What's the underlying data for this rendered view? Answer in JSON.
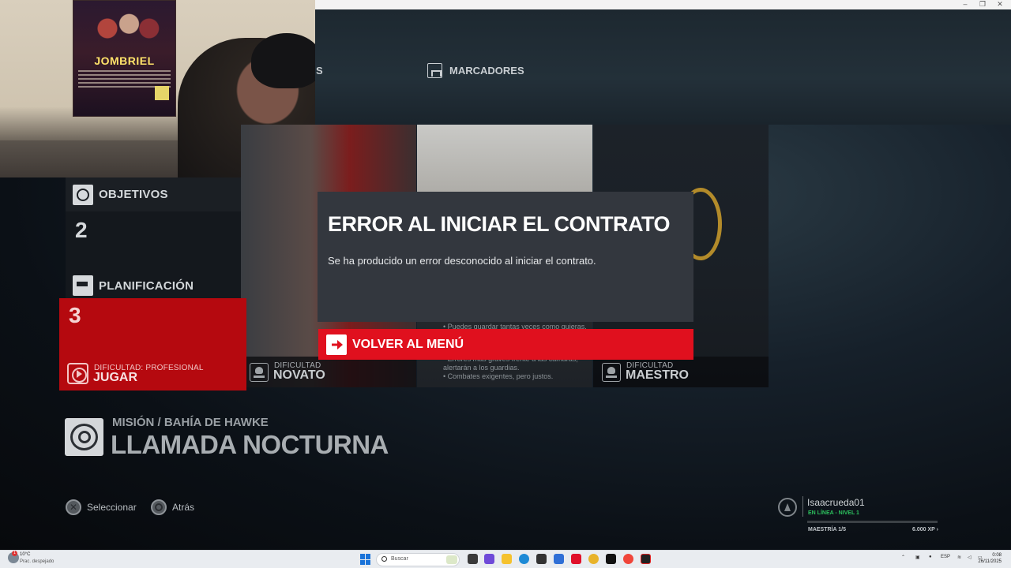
{
  "window": {
    "minimize": "–",
    "restore": "❐",
    "close": "✕"
  },
  "tabs": {
    "partial_left": "S",
    "marcadores": "MARCADORES"
  },
  "poster": {
    "title": "JOMBRIEL"
  },
  "menu": {
    "objetivos": {
      "label": "OBJETIVOS",
      "number": "2"
    },
    "planificacion": {
      "label": "PLANIFICACIÓN",
      "number": "3"
    },
    "play": {
      "difficulty_prefix": "DIFICULTAD: PROFESIONAL",
      "label": "JUGAR"
    }
  },
  "difficulties": {
    "novato": {
      "prefix": "DIFICULTAD",
      "label": "NOVATO"
    },
    "maestro": {
      "prefix": "DIFICULTAD",
      "label": "MAESTRO"
    },
    "bullets_top": "• Puedes guardar tantas veces como quieras.",
    "bullets": [
      "• Errores más graves frente a las cámaras,",
      "alertarán a los guardias.",
      "• Combates exigentes, pero justos."
    ]
  },
  "dialog": {
    "title": "ERROR AL INICIAR EL CONTRATO",
    "message": "Se ha producido un error desconocido al iniciar el contrato.",
    "back_button": "VOLVER AL MENÚ"
  },
  "mission": {
    "subtitle": "MISIÓN / BAHÍA DE HAWKE",
    "title": "LLAMADA NOCTURNA"
  },
  "controls": {
    "select": "Seleccionar",
    "back": "Atrás"
  },
  "profile": {
    "name": "Isaacrueda01",
    "status": "EN LÍNEA - NIVEL 1",
    "mastery": "MAESTRÍA 1/5",
    "xp": "6.000 XP ›",
    "mastery_progress": 0.0
  },
  "taskbar": {
    "badge": "1",
    "temperature": "10°C",
    "weather": "Prac. despejado",
    "search_placeholder": "Buscar",
    "lang": "ESP",
    "time": "0:08",
    "date": "26/11/2025"
  },
  "colors": {
    "accent_red": "#e0101e",
    "card_red": "#b5090f",
    "online_green": "#2cc05d"
  }
}
